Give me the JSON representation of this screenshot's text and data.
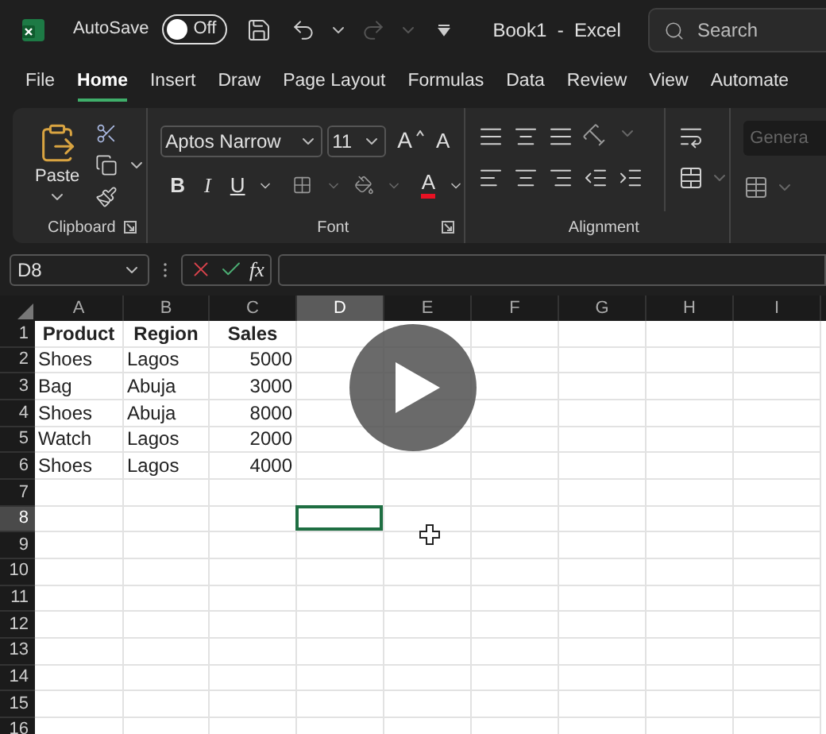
{
  "window": {
    "title": "Book1  -  Excel"
  },
  "autosave": {
    "label": "AutoSave",
    "on": false,
    "state_text": "Off"
  },
  "search": {
    "placeholder": "Search"
  },
  "tabs": [
    {
      "label": "File",
      "selected": false
    },
    {
      "label": "Home",
      "selected": true
    },
    {
      "label": "Insert",
      "selected": false
    },
    {
      "label": "Draw",
      "selected": false
    },
    {
      "label": "Page Layout",
      "selected": false
    },
    {
      "label": "Formulas",
      "selected": false
    },
    {
      "label": "Data",
      "selected": false
    },
    {
      "label": "Review",
      "selected": false
    },
    {
      "label": "View",
      "selected": false
    },
    {
      "label": "Automate",
      "selected": false
    }
  ],
  "ribbon": {
    "clipboard": {
      "paste": "Paste",
      "label": "Clipboard"
    },
    "font": {
      "name": "Aptos Narrow",
      "size": "11",
      "grow": "A",
      "shrink": "A",
      "bold": "B",
      "italic": "I",
      "underline": "U",
      "font_color": "A",
      "label": "Font"
    },
    "alignment": {
      "label": "Alignment"
    },
    "number": {
      "format": "Genera"
    }
  },
  "formula_bar": {
    "name_box": "D8",
    "fx": "fx"
  },
  "sheet": {
    "columns": [
      {
        "label": "A",
        "selected": false
      },
      {
        "label": "B",
        "selected": false
      },
      {
        "label": "C",
        "selected": false
      },
      {
        "label": "D",
        "selected": true
      },
      {
        "label": "E",
        "selected": false
      },
      {
        "label": "F",
        "selected": false
      },
      {
        "label": "G",
        "selected": false
      },
      {
        "label": "H",
        "selected": false
      },
      {
        "label": "I",
        "selected": false
      }
    ],
    "rows": [
      {
        "label": "1",
        "selected": false,
        "kind": "header",
        "cells": [
          {
            "text": "Product"
          },
          {
            "text": "Region"
          },
          {
            "text": "Sales"
          }
        ]
      },
      {
        "label": "2",
        "selected": false,
        "kind": "data",
        "cells": [
          {
            "text": "Shoes",
            "kind": "text"
          },
          {
            "text": "Lagos",
            "kind": "text"
          },
          {
            "text": "5000",
            "kind": "number"
          }
        ]
      },
      {
        "label": "3",
        "selected": false,
        "kind": "data",
        "cells": [
          {
            "text": "Bag",
            "kind": "text"
          },
          {
            "text": "Abuja",
            "kind": "text"
          },
          {
            "text": "3000",
            "kind": "number"
          }
        ]
      },
      {
        "label": "4",
        "selected": false,
        "kind": "data",
        "cells": [
          {
            "text": "Shoes",
            "kind": "text"
          },
          {
            "text": "Abuja",
            "kind": "text"
          },
          {
            "text": "8000",
            "kind": "number"
          }
        ]
      },
      {
        "label": "5",
        "selected": false,
        "kind": "data",
        "cells": [
          {
            "text": "Watch",
            "kind": "text"
          },
          {
            "text": "Lagos",
            "kind": "text"
          },
          {
            "text": "2000",
            "kind": "number"
          }
        ]
      },
      {
        "label": "6",
        "selected": false,
        "kind": "data",
        "cells": [
          {
            "text": "Shoes",
            "kind": "text"
          },
          {
            "text": "Lagos",
            "kind": "text"
          },
          {
            "text": "4000",
            "kind": "number"
          }
        ]
      },
      {
        "label": "7",
        "selected": false,
        "kind": "data",
        "cells": []
      },
      {
        "label": "8",
        "selected": true,
        "kind": "data",
        "cells": []
      },
      {
        "label": "9",
        "selected": false,
        "kind": "data",
        "cells": []
      },
      {
        "label": "10",
        "selected": false,
        "kind": "data",
        "cells": []
      },
      {
        "label": "11",
        "selected": false,
        "kind": "data",
        "cells": []
      },
      {
        "label": "12",
        "selected": false,
        "kind": "data",
        "cells": []
      },
      {
        "label": "13",
        "selected": false,
        "kind": "data",
        "cells": []
      },
      {
        "label": "14",
        "selected": false,
        "kind": "data",
        "cells": []
      },
      {
        "label": "15",
        "selected": false,
        "kind": "data",
        "cells": []
      },
      {
        "label": "16",
        "selected": false,
        "kind": "data",
        "cells": []
      }
    ]
  },
  "video": {
    "play_button": true
  }
}
